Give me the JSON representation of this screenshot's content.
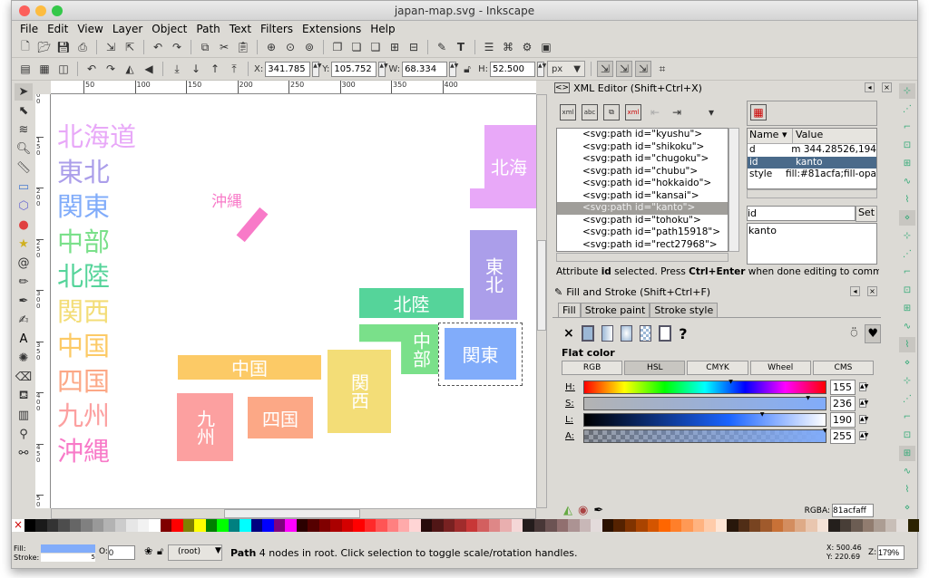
{
  "window": {
    "title": "japan-map.svg - Inkscape"
  },
  "menu": [
    "File",
    "Edit",
    "View",
    "Layer",
    "Object",
    "Path",
    "Text",
    "Filters",
    "Extensions",
    "Help"
  ],
  "commands_toolbar": [
    "new-icon",
    "open-icon",
    "save-icon",
    "print-icon",
    "import-icon",
    "export-icon",
    "undo-icon",
    "redo-icon",
    "copy-icon",
    "cut-icon",
    "paste-icon",
    "zoom-selection-icon",
    "zoom-drawing-icon",
    "zoom-page-icon",
    "duplicate-icon",
    "clone-icon",
    "unlink-clone-icon",
    "group-icon",
    "ungroup-icon",
    "fill-stroke-icon",
    "text-font-icon",
    "layers-icon",
    "xml-editor-icon",
    "preferences-icon",
    "document-properties-icon"
  ],
  "select_toolbar": {
    "x_label": "X:",
    "x": "341.785",
    "y_label": "Y:",
    "y": "105.752",
    "w_label": "W:",
    "w": "68.334",
    "h_label": "H:",
    "h": "52.500",
    "unit": "px"
  },
  "tools": [
    "selector",
    "node",
    "tweak",
    "zoom",
    "measure",
    "rect",
    "3dbox",
    "ellipse",
    "star",
    "spiral",
    "pencil",
    "pen",
    "calligraphy",
    "text",
    "spray",
    "eraser",
    "bucket",
    "gradient",
    "dropper",
    "connector"
  ],
  "ruler": {
    "top": [
      "50",
      "100",
      "150",
      "200",
      "250",
      "300",
      "350",
      "400"
    ],
    "left": [
      "100",
      "150",
      "200",
      "250",
      "300",
      "350",
      "400",
      "450",
      "500"
    ]
  },
  "legend": [
    {
      "label": "北海道",
      "color": "#e8a8f8"
    },
    {
      "label": "東北",
      "color": "#ab9eea"
    },
    {
      "label": "関東",
      "color": "#81acfa"
    },
    {
      "label": "中部",
      "color": "#7ae08a"
    },
    {
      "label": "北陸",
      "color": "#55d49a"
    },
    {
      "label": "関西",
      "color": "#f3dd77"
    },
    {
      "label": "中国",
      "color": "#fcca66"
    },
    {
      "label": "四国",
      "color": "#fca886"
    },
    {
      "label": "九州",
      "color": "#fca0a0"
    },
    {
      "label": "沖縄",
      "color": "#f87ac8"
    }
  ],
  "map": {
    "hokkaido": "北海",
    "tohoku": "東北",
    "kanto": "関東",
    "chubu": "中部",
    "hokuriku": "北陸",
    "kansai": "関西",
    "chugoku": "中国",
    "shikoku": "四国",
    "kyushu": "九州",
    "okinawa": "沖縄"
  },
  "xml_editor": {
    "title": "XML Editor (Shift+Ctrl+X)",
    "nodes": [
      "<svg:path id=\"kyushu\">",
      "<svg:path id=\"shikoku\">",
      "<svg:path id=\"chugoku\">",
      "<svg:path id=\"chubu\">",
      "<svg:path id=\"hokkaido\">",
      "<svg:path id=\"kansai\">",
      "<svg:path id=\"kanto\">",
      "<svg:path id=\"tohoku\">",
      "<svg:path id=\"path15918\">",
      "<svg:path id=\"rect27968\">"
    ],
    "selected_index": 6,
    "attr_headers": {
      "name": "Name",
      "value": "Value"
    },
    "attributes": [
      {
        "name": "d",
        "value": "m 344.28526,194"
      },
      {
        "name": "id",
        "value": "kanto"
      },
      {
        "name": "style",
        "value": "fill:#81acfa;fill-opa"
      }
    ],
    "attr_name": "id",
    "set_label": "Set",
    "attr_value": "kanto",
    "status_pre": "Attribute ",
    "status_bold1": "id",
    "status_mid": " selected. Press ",
    "status_bold2": "Ctrl+Enter",
    "status_post": " when done editing to commit c"
  },
  "fill_stroke": {
    "title": "Fill and Stroke (Shift+Ctrl+F)",
    "tabs": [
      "Fill",
      "Stroke paint",
      "Stroke style"
    ],
    "mode": "Flat color",
    "color_modes": [
      "RGB",
      "HSL",
      "CMYK",
      "Wheel",
      "CMS"
    ],
    "active_mode": "HSL",
    "sliders": [
      {
        "label": "H:",
        "value": "155",
        "fraction": 0.61
      },
      {
        "label": "S:",
        "value": "236",
        "fraction": 0.93
      },
      {
        "label": "L:",
        "value": "190",
        "fraction": 0.74
      },
      {
        "label": "A:",
        "value": "255",
        "fraction": 1.0
      }
    ],
    "rgba_label": "RGBA:",
    "rgba": "81acfaff",
    "paint_x": "×",
    "paint_unknown": "?"
  },
  "status": {
    "fill_label": "Fill:",
    "stroke_label": "Stroke:",
    "fill_color": "#81acfa",
    "stroke_width": "5",
    "opacity_label": "O:",
    "opacity": "0",
    "layer": "(root)",
    "msg_bold": "Path",
    "msg": " 4 nodes in root. Click selection to toggle scale/rotation handles.",
    "cx": "X:  500.46",
    "cy": "Y:  220.69",
    "zoom_label": "Z:",
    "zoom": "179%"
  },
  "palette": [
    "#000000",
    "#1a1a1a",
    "#333333",
    "#4d4d4d",
    "#666666",
    "#808080",
    "#999999",
    "#b3b3b3",
    "#cccccc",
    "#e6e6e6",
    "#f2f2f2",
    "#ffffff",
    "#800000",
    "#ff0000",
    "#808000",
    "#ffff00",
    "#008000",
    "#00ff00",
    "#008080",
    "#00ffff",
    "#000080",
    "#0000ff",
    "#800080",
    "#ff00ff",
    "#2b0000",
    "#550000",
    "#800000",
    "#aa0000",
    "#d40000",
    "#ff0000",
    "#ff2a2a",
    "#ff5555",
    "#ff8080",
    "#ffaaaa",
    "#ffd5d5",
    "#280b0b",
    "#501616",
    "#782121",
    "#a02c2c",
    "#c83737",
    "#d35f5f",
    "#de8787",
    "#e9afaf",
    "#f4d7d7",
    "#241c1c",
    "#483737",
    "#6c5353",
    "#916f6f",
    "#ac9393",
    "#c8b7b7",
    "#e3dbdb",
    "#2b1100",
    "#552200",
    "#803300",
    "#aa4400",
    "#d45500",
    "#ff6600",
    "#ff7f2a",
    "#ff9955",
    "#ffb380",
    "#ffccaa",
    "#ffe6d5",
    "#28170b",
    "#502d16",
    "#784421",
    "#a05a2c",
    "#c87137",
    "#d38d5f",
    "#deaa87",
    "#e9c6af",
    "#f4e3d7",
    "#241f1c",
    "#483e37",
    "#6c5d53",
    "#917c6f",
    "#ac9d93",
    "#c8beb7",
    "#e3dedb",
    "#2b2200"
  ]
}
